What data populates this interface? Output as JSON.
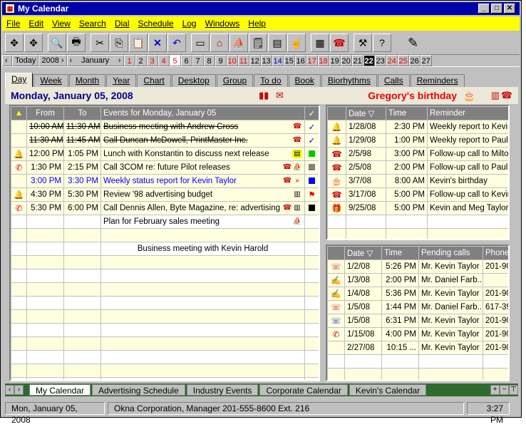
{
  "window": {
    "title": "My Calendar"
  },
  "menu": [
    "File",
    "Edit",
    "View",
    "Search",
    "Dial",
    "Schedule",
    "Log",
    "Windows",
    "Help"
  ],
  "datebar": {
    "today_label": "Today",
    "year": "2008",
    "month": "January",
    "days": [
      "1",
      "2",
      "3",
      "4",
      "5",
      "6",
      "7",
      "8",
      "9",
      "10",
      "11",
      "12",
      "13",
      "14",
      "15",
      "16",
      "17",
      "18",
      "19",
      "20",
      "21",
      "22",
      "23",
      "24",
      "25",
      "26",
      "27"
    ]
  },
  "view_tabs": [
    "Day",
    "Week",
    "Month",
    "Year",
    "Chart",
    "Desktop",
    "Group",
    "To do",
    "Book",
    "Biorhythms",
    "Calls",
    "Reminders"
  ],
  "header": {
    "date": "Monday, January 05, 2008",
    "birthday": "Gregory's birthday"
  },
  "events": {
    "columns": [
      "",
      "From",
      "To",
      "Events for Monday, January 05",
      ""
    ],
    "rows": [
      {
        "from": "10:00 AM",
        "to": "11:30 AM",
        "text": "Business meeting with Andrew Cross",
        "style": "strike",
        "icon": "☎",
        "check": "✓"
      },
      {
        "from": "11:30 AM",
        "to": "11:45 AM",
        "text": "Call Duncan McDowell, PrintMaster Inc.",
        "style": "strike",
        "icon": "☎",
        "check": "✓"
      },
      {
        "from": "12:00 PM",
        "to": "1:05 PM",
        "text": "Lunch with Konstantin to discuss next release",
        "style": "",
        "icon": "▤",
        "check": ""
      },
      {
        "from": "1:30 PM",
        "to": "2:15 PM",
        "text": "Call 3COM re: future Pilot releases",
        "style": "",
        "icon": "☎",
        "check": ""
      },
      {
        "from": "3:00 PM",
        "to": "3:30 PM",
        "text": "Weekly status report for Kevin Taylor",
        "style": "blue",
        "icon": "☎",
        "check": ""
      },
      {
        "from": "4:30 PM",
        "to": "5:30 PM",
        "text": "Review '98 advertising budget",
        "style": "",
        "icon": "▥",
        "check": ""
      },
      {
        "from": "5:30 PM",
        "to": "6:00 PM",
        "text": "Call Dennis Allen, Byte Magazine, re: advertising",
        "style": "",
        "icon": "☎",
        "check": ""
      },
      {
        "from": "",
        "to": "",
        "text": "Plan for February sales meeting",
        "style": "",
        "icon": "⛵",
        "check": ""
      }
    ],
    "floating_note": "Business meeting with Kevin Harold"
  },
  "reminders": {
    "columns": [
      "",
      "Date",
      "Time",
      "Reminder"
    ],
    "rows": [
      {
        "date": "1/28/08",
        "time": "2:30 PM",
        "text": "Weekly report to Kevin"
      },
      {
        "date": "1/29/08",
        "time": "1:00 PM",
        "text": "Weekly report to Paul T"
      },
      {
        "date": "2/5/98",
        "time": "3:00 PM",
        "text": "Follow-up call to Milton"
      },
      {
        "date": "2/5/08",
        "time": "2:00 PM",
        "text": "Follow-up call to Paul"
      },
      {
        "date": "3/7/08",
        "time": "8:00 AM",
        "text": "Kevin's birthday"
      },
      {
        "date": "3/17/08",
        "time": "5:00 PM",
        "text": "Follow-up call to Kevin"
      },
      {
        "date": "9/25/08",
        "time": "5:00 PM",
        "text": "Kevin and Meg Taylor"
      }
    ]
  },
  "calls": {
    "columns": [
      "",
      "Date",
      "Time",
      "Pending calls",
      "Phone"
    ],
    "rows": [
      {
        "date": "1/2/08",
        "time": "5:26 PM",
        "name": "Mr. Kevin Taylor",
        "phone": "201-90"
      },
      {
        "date": "1/3/08",
        "time": "2:00 PM",
        "name": "Mr. Daniel Farb...",
        "phone": ""
      },
      {
        "date": "1/4/08",
        "time": "5:36 PM",
        "name": "Mr. Kevin Taylor",
        "phone": "201-90"
      },
      {
        "date": "1/5/08",
        "time": "1:44 PM",
        "name": "Mr. Daniel Farb...",
        "phone": "617-39"
      },
      {
        "date": "1/5/08",
        "time": "6:31 PM",
        "name": "Mr. Kevin Taylor",
        "phone": "201-90"
      },
      {
        "date": "1/15/08",
        "time": "4:00 PM",
        "name": "Mr. Kevin Taylor",
        "phone": "201-90"
      },
      {
        "date": "2/27/08",
        "time": "10:15 ...",
        "name": "Mr. Kevin Taylor",
        "phone": "201-90"
      }
    ]
  },
  "bottom_tabs": [
    "My Calendar",
    "Advertising Schedule",
    "Industry Events",
    "Corporate Calendar",
    "Kevin's Calendar"
  ],
  "status": {
    "date": "Mon, January 05, 2008",
    "info": "Okna Corporation, Manager 201-555-8600  Ext. 216",
    "time": "3:27 PM"
  },
  "colors": {
    "accent": "#0000a8",
    "menu": "#ffff00",
    "red": "#ee0000",
    "highlight": "#ffffe0"
  }
}
